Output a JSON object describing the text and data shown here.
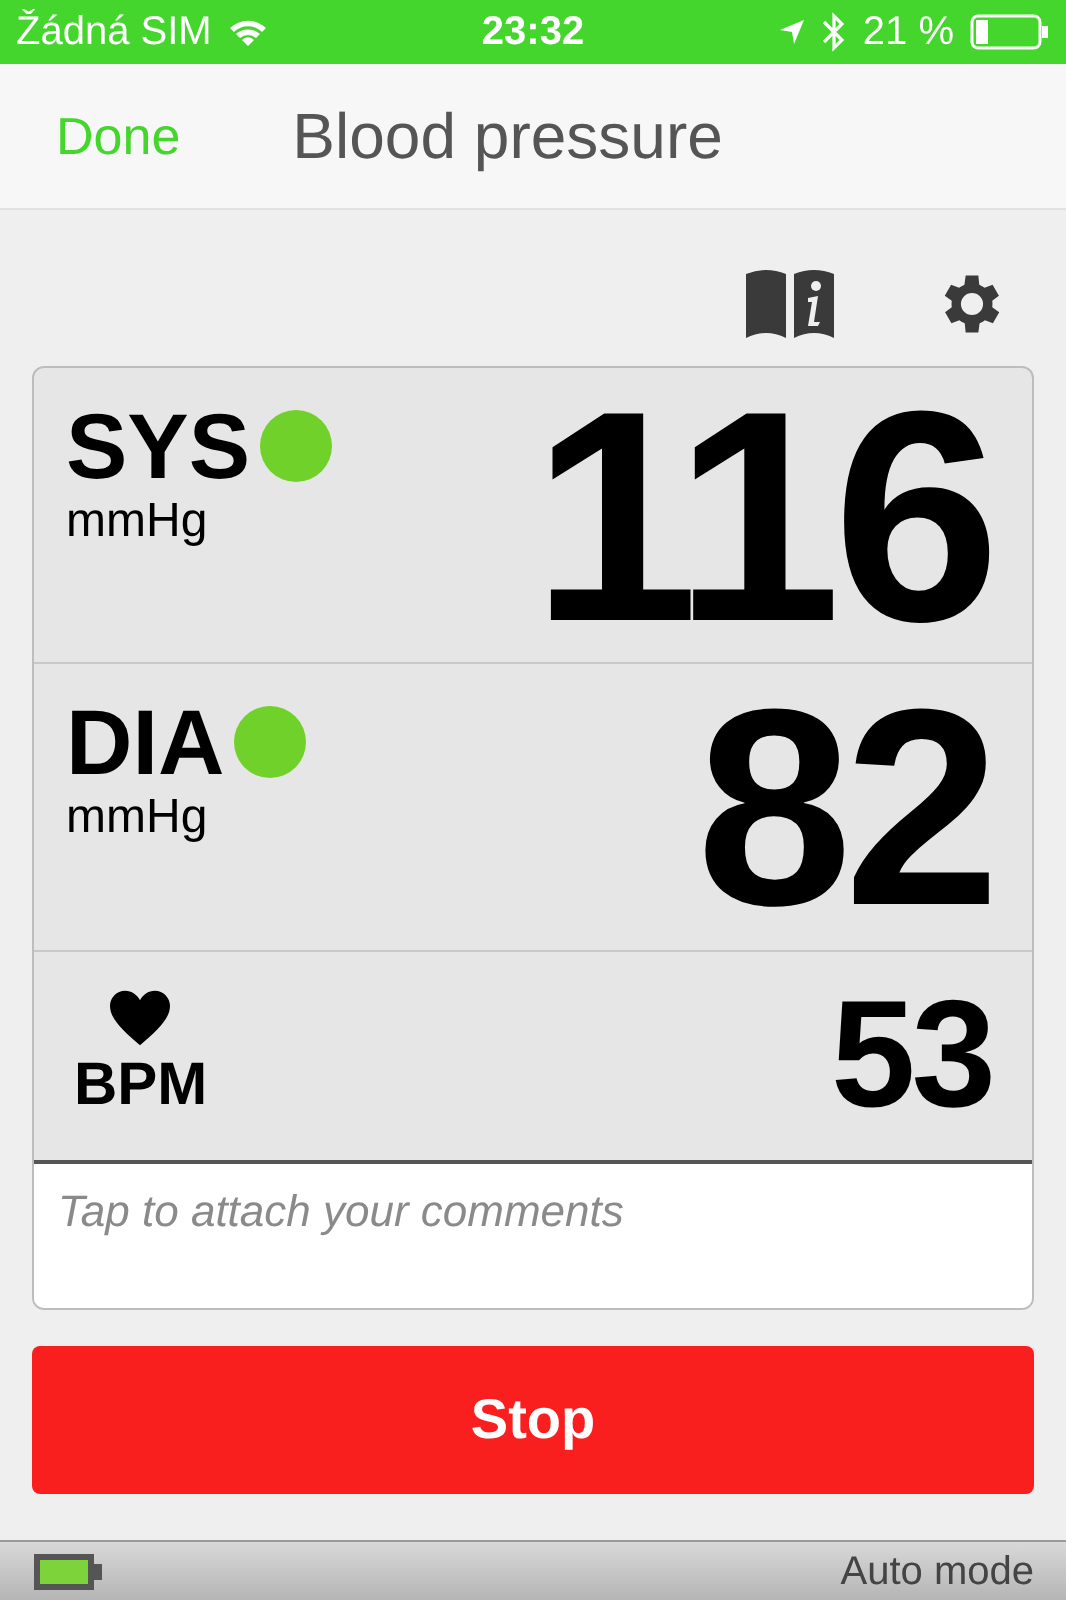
{
  "status_bar": {
    "carrier": "Žádná SIM",
    "time": "23:32",
    "battery": "21 %"
  },
  "nav": {
    "back": "Done",
    "title": "Blood pressure"
  },
  "readings": [
    {
      "kind": "pressure",
      "label": "SYS",
      "unit": "mmHg",
      "value": "116",
      "color": "#6fd12a"
    },
    {
      "kind": "pressure",
      "label": "DIA",
      "unit": "mmHg",
      "value": "82",
      "color": "#6fd12a"
    },
    {
      "kind": "pulse",
      "label": "BPM",
      "value": "53"
    }
  ],
  "comments": {
    "placeholder": "Tap to attach your comments"
  },
  "action": "Stop",
  "footer": {
    "mode": "Auto mode"
  }
}
